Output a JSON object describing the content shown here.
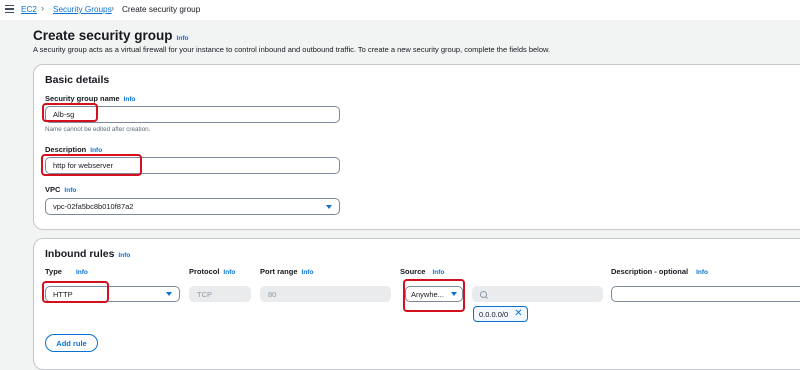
{
  "breadcrumb": {
    "ec2": "EC2",
    "security_groups": "Security Groups",
    "current": "Create security group"
  },
  "page": {
    "title": "Create security group",
    "info": "Info",
    "description": "A security group acts as a virtual firewall for your instance to control inbound and outbound traffic. To create a new security group, complete the fields below."
  },
  "basic_details": {
    "title": "Basic details",
    "name_label": "Security group name",
    "name_info": "Info",
    "name_value": "Alb-sg",
    "name_hint": "Name cannot be edited after creation.",
    "description_label": "Description",
    "description_info": "Info",
    "description_value": "http for webserver",
    "vpc_label": "VPC",
    "vpc_info": "Info",
    "vpc_value": "vpc-02fa5bc8b010f87a2"
  },
  "inbound_rules": {
    "title": "Inbound rules",
    "info": "Info",
    "columns": {
      "type": "Type",
      "type_info": "Info",
      "protocol": "Protocol",
      "protocol_info": "Info",
      "port_range": "Port range",
      "port_range_info": "Info",
      "source": "Source",
      "source_info": "Info",
      "description": "Description - optional",
      "description_info": "Info"
    },
    "rule": {
      "type": "HTTP",
      "protocol": "TCP",
      "port_range": "80",
      "source": "Anywhe...",
      "source_token": "0.0.0.0/0",
      "description": ""
    },
    "add_rule": "Add rule"
  },
  "icons": {
    "menu": "hamburger-menu-icon",
    "separator": "chevron-right-icon",
    "dropdown": "caret-down-icon",
    "search": "search-icon",
    "remove": "close-icon"
  },
  "colors": {
    "link": "#0972d3",
    "highlight": "#d40f1e",
    "background": "#f2f3f3"
  }
}
